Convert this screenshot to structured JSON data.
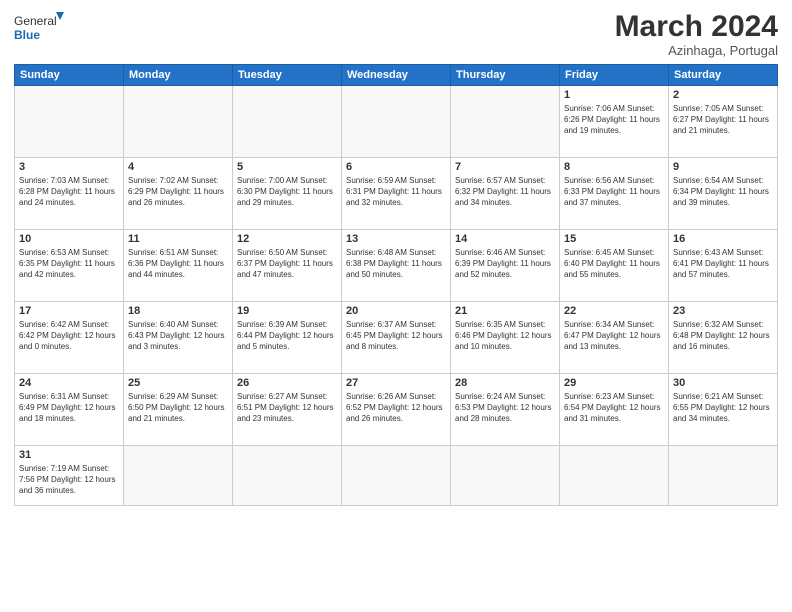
{
  "header": {
    "logo_general": "General",
    "logo_blue": "Blue",
    "month_title": "March 2024",
    "subtitle": "Azinhaga, Portugal"
  },
  "weekdays": [
    "Sunday",
    "Monday",
    "Tuesday",
    "Wednesday",
    "Thursday",
    "Friday",
    "Saturday"
  ],
  "weeks": [
    [
      {
        "day": "",
        "info": ""
      },
      {
        "day": "",
        "info": ""
      },
      {
        "day": "",
        "info": ""
      },
      {
        "day": "",
        "info": ""
      },
      {
        "day": "",
        "info": ""
      },
      {
        "day": "1",
        "info": "Sunrise: 7:06 AM\nSunset: 6:26 PM\nDaylight: 11 hours and 19 minutes."
      },
      {
        "day": "2",
        "info": "Sunrise: 7:05 AM\nSunset: 6:27 PM\nDaylight: 11 hours and 21 minutes."
      }
    ],
    [
      {
        "day": "3",
        "info": "Sunrise: 7:03 AM\nSunset: 6:28 PM\nDaylight: 11 hours and 24 minutes."
      },
      {
        "day": "4",
        "info": "Sunrise: 7:02 AM\nSunset: 6:29 PM\nDaylight: 11 hours and 26 minutes."
      },
      {
        "day": "5",
        "info": "Sunrise: 7:00 AM\nSunset: 6:30 PM\nDaylight: 11 hours and 29 minutes."
      },
      {
        "day": "6",
        "info": "Sunrise: 6:59 AM\nSunset: 6:31 PM\nDaylight: 11 hours and 32 minutes."
      },
      {
        "day": "7",
        "info": "Sunrise: 6:57 AM\nSunset: 6:32 PM\nDaylight: 11 hours and 34 minutes."
      },
      {
        "day": "8",
        "info": "Sunrise: 6:56 AM\nSunset: 6:33 PM\nDaylight: 11 hours and 37 minutes."
      },
      {
        "day": "9",
        "info": "Sunrise: 6:54 AM\nSunset: 6:34 PM\nDaylight: 11 hours and 39 minutes."
      }
    ],
    [
      {
        "day": "10",
        "info": "Sunrise: 6:53 AM\nSunset: 6:35 PM\nDaylight: 11 hours and 42 minutes."
      },
      {
        "day": "11",
        "info": "Sunrise: 6:51 AM\nSunset: 6:36 PM\nDaylight: 11 hours and 44 minutes."
      },
      {
        "day": "12",
        "info": "Sunrise: 6:50 AM\nSunset: 6:37 PM\nDaylight: 11 hours and 47 minutes."
      },
      {
        "day": "13",
        "info": "Sunrise: 6:48 AM\nSunset: 6:38 PM\nDaylight: 11 hours and 50 minutes."
      },
      {
        "day": "14",
        "info": "Sunrise: 6:46 AM\nSunset: 6:39 PM\nDaylight: 11 hours and 52 minutes."
      },
      {
        "day": "15",
        "info": "Sunrise: 6:45 AM\nSunset: 6:40 PM\nDaylight: 11 hours and 55 minutes."
      },
      {
        "day": "16",
        "info": "Sunrise: 6:43 AM\nSunset: 6:41 PM\nDaylight: 11 hours and 57 minutes."
      }
    ],
    [
      {
        "day": "17",
        "info": "Sunrise: 6:42 AM\nSunset: 6:42 PM\nDaylight: 12 hours and 0 minutes."
      },
      {
        "day": "18",
        "info": "Sunrise: 6:40 AM\nSunset: 6:43 PM\nDaylight: 12 hours and 3 minutes."
      },
      {
        "day": "19",
        "info": "Sunrise: 6:39 AM\nSunset: 6:44 PM\nDaylight: 12 hours and 5 minutes."
      },
      {
        "day": "20",
        "info": "Sunrise: 6:37 AM\nSunset: 6:45 PM\nDaylight: 12 hours and 8 minutes."
      },
      {
        "day": "21",
        "info": "Sunrise: 6:35 AM\nSunset: 6:46 PM\nDaylight: 12 hours and 10 minutes."
      },
      {
        "day": "22",
        "info": "Sunrise: 6:34 AM\nSunset: 6:47 PM\nDaylight: 12 hours and 13 minutes."
      },
      {
        "day": "23",
        "info": "Sunrise: 6:32 AM\nSunset: 6:48 PM\nDaylight: 12 hours and 16 minutes."
      }
    ],
    [
      {
        "day": "24",
        "info": "Sunrise: 6:31 AM\nSunset: 6:49 PM\nDaylight: 12 hours and 18 minutes."
      },
      {
        "day": "25",
        "info": "Sunrise: 6:29 AM\nSunset: 6:50 PM\nDaylight: 12 hours and 21 minutes."
      },
      {
        "day": "26",
        "info": "Sunrise: 6:27 AM\nSunset: 6:51 PM\nDaylight: 12 hours and 23 minutes."
      },
      {
        "day": "27",
        "info": "Sunrise: 6:26 AM\nSunset: 6:52 PM\nDaylight: 12 hours and 26 minutes."
      },
      {
        "day": "28",
        "info": "Sunrise: 6:24 AM\nSunset: 6:53 PM\nDaylight: 12 hours and 28 minutes."
      },
      {
        "day": "29",
        "info": "Sunrise: 6:23 AM\nSunset: 6:54 PM\nDaylight: 12 hours and 31 minutes."
      },
      {
        "day": "30",
        "info": "Sunrise: 6:21 AM\nSunset: 6:55 PM\nDaylight: 12 hours and 34 minutes."
      }
    ],
    [
      {
        "day": "31",
        "info": "Sunrise: 7:19 AM\nSunset: 7:56 PM\nDaylight: 12 hours and 36 minutes."
      },
      {
        "day": "",
        "info": ""
      },
      {
        "day": "",
        "info": ""
      },
      {
        "day": "",
        "info": ""
      },
      {
        "day": "",
        "info": ""
      },
      {
        "day": "",
        "info": ""
      },
      {
        "day": "",
        "info": ""
      }
    ]
  ]
}
